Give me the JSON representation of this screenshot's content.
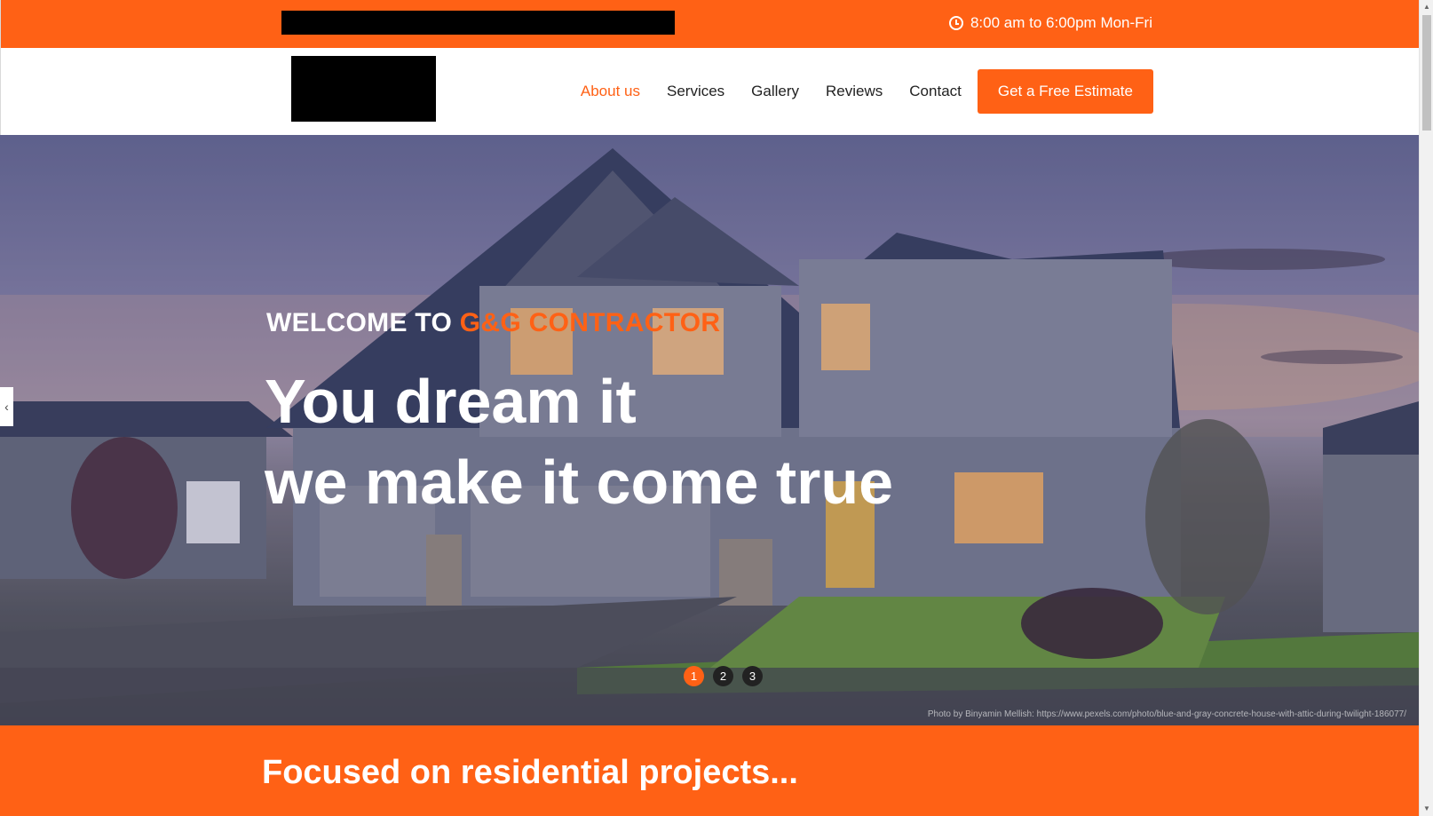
{
  "topbar": {
    "hours": "8:00 am to 6:00pm Mon-Fri",
    "hours_icon": "clock-icon"
  },
  "nav": {
    "items": [
      {
        "label": "About us",
        "active": true
      },
      {
        "label": "Services",
        "active": false
      },
      {
        "label": "Gallery",
        "active": false
      },
      {
        "label": "Reviews",
        "active": false
      },
      {
        "label": "Contact",
        "active": false
      }
    ],
    "cta_label": "Get a Free Estimate"
  },
  "hero": {
    "kicker_prefix": "WELCOME TO",
    "kicker_brand": "G&G CONTRACTOR",
    "title_line1": "You dream it",
    "title_line2": "we make it come true",
    "prev_arrow": "‹",
    "dots": [
      "1",
      "2",
      "3"
    ],
    "active_dot": 1,
    "photo_credit": "Photo by Binyamin Mellish: https://www.pexels.com/photo/blue-and-gray-concrete-house-with-attic-during-twilight-186077/"
  },
  "band": {
    "title": "Focused on residential projects..."
  },
  "colors": {
    "brand_orange": "#ff6115",
    "text_dark": "#222222",
    "white": "#ffffff"
  }
}
